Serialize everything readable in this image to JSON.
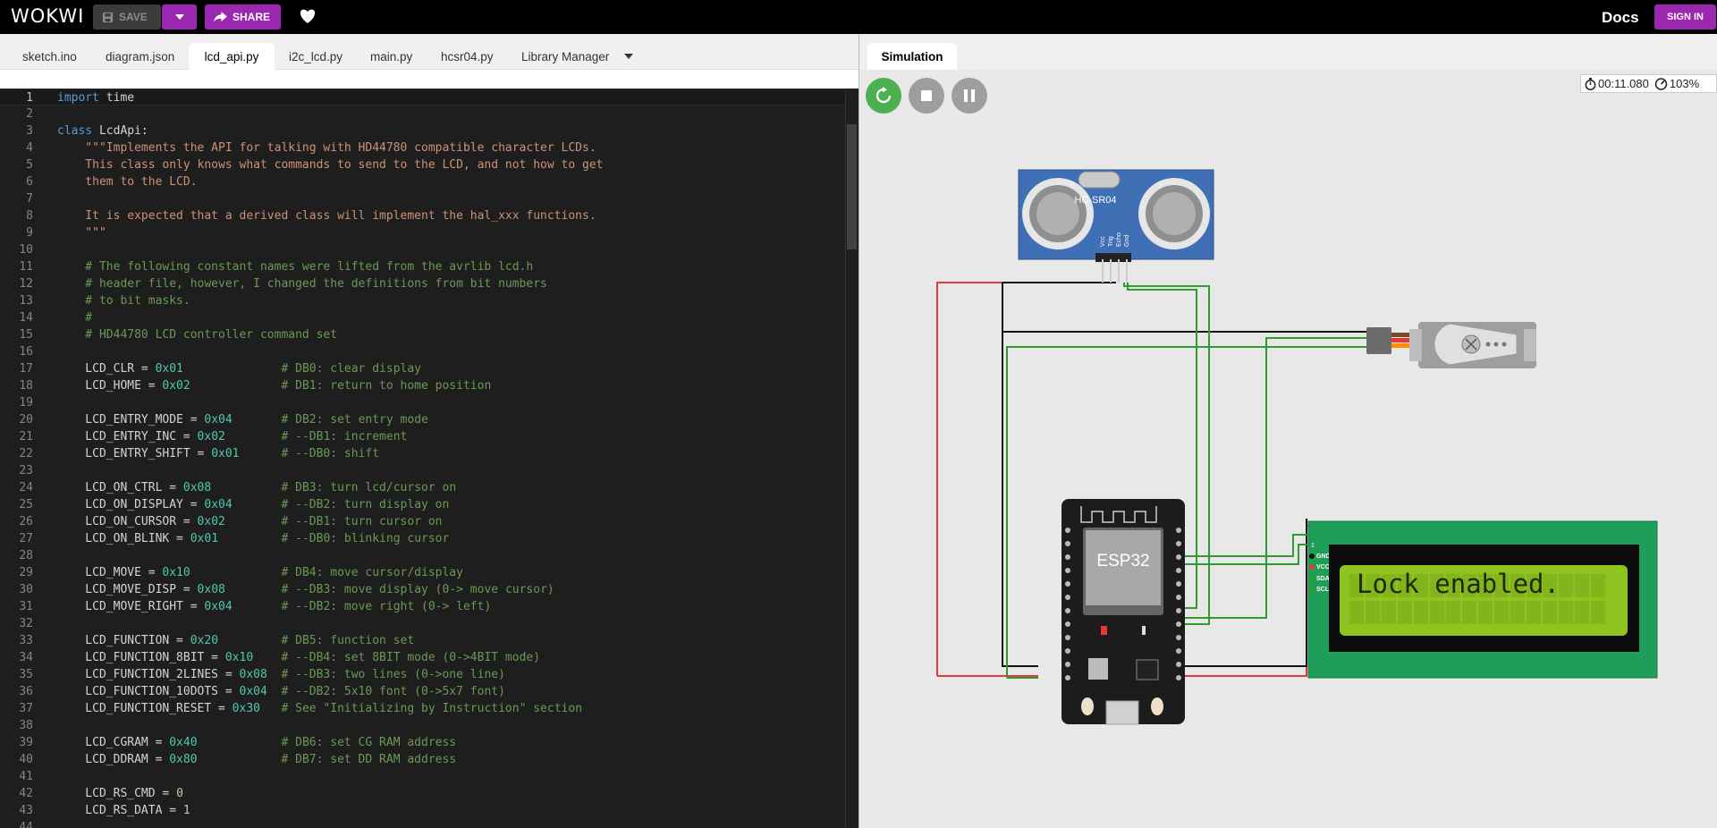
{
  "topbar": {
    "logo": "WOKWI",
    "save_label": "SAVE",
    "share_label": "SHARE",
    "docs_label": "Docs",
    "signin_label": "SIGN IN"
  },
  "editor": {
    "tabs": [
      {
        "label": "sketch.ino"
      },
      {
        "label": "diagram.json"
      },
      {
        "label": "lcd_api.py"
      },
      {
        "label": "i2c_lcd.py"
      },
      {
        "label": "main.py"
      },
      {
        "label": "hcsr04.py"
      },
      {
        "label": "Library Manager"
      }
    ],
    "active_tab": "lcd_api.py",
    "lines": [
      [
        [
          "kw",
          "import"
        ],
        [
          "t",
          " time"
        ]
      ],
      [],
      [
        [
          "kw",
          "class"
        ],
        [
          "t",
          " LcdApi:"
        ]
      ],
      [
        [
          "str",
          "    \"\"\"Implements the API for talking with HD44780 compatible character LCDs."
        ]
      ],
      [
        [
          "str",
          "    This class only knows what commands to send to the LCD, and not how to get"
        ]
      ],
      [
        [
          "str",
          "    them to the LCD."
        ]
      ],
      [],
      [
        [
          "str",
          "    It is expected that a derived class will implement the hal_xxx functions."
        ]
      ],
      [
        [
          "str",
          "    \"\"\""
        ]
      ],
      [],
      [
        [
          "cm",
          "    # The following constant names were lifted from the avrlib lcd.h"
        ]
      ],
      [
        [
          "cm",
          "    # header file, however, I changed the definitions from bit numbers"
        ]
      ],
      [
        [
          "cm",
          "    # to bit masks."
        ]
      ],
      [
        [
          "cm",
          "    #"
        ]
      ],
      [
        [
          "cm",
          "    # HD44780 LCD controller command set"
        ]
      ],
      [],
      [
        [
          "t",
          "    LCD_CLR = "
        ],
        [
          "hex",
          "0x01"
        ],
        [
          "t",
          "              "
        ],
        [
          "cm",
          "# DB0: clear display"
        ]
      ],
      [
        [
          "t",
          "    LCD_HOME = "
        ],
        [
          "hex",
          "0x02"
        ],
        [
          "t",
          "             "
        ],
        [
          "cm",
          "# DB1: return to home position"
        ]
      ],
      [],
      [
        [
          "t",
          "    LCD_ENTRY_MODE = "
        ],
        [
          "hex",
          "0x04"
        ],
        [
          "t",
          "       "
        ],
        [
          "cm",
          "# DB2: set entry mode"
        ]
      ],
      [
        [
          "t",
          "    LCD_ENTRY_INC = "
        ],
        [
          "hex",
          "0x02"
        ],
        [
          "t",
          "        "
        ],
        [
          "cm",
          "# --DB1: increment"
        ]
      ],
      [
        [
          "t",
          "    LCD_ENTRY_SHIFT = "
        ],
        [
          "hex",
          "0x01"
        ],
        [
          "t",
          "      "
        ],
        [
          "cm",
          "# --DB0: shift"
        ]
      ],
      [],
      [
        [
          "t",
          "    LCD_ON_CTRL = "
        ],
        [
          "hex",
          "0x08"
        ],
        [
          "t",
          "          "
        ],
        [
          "cm",
          "# DB3: turn lcd/cursor on"
        ]
      ],
      [
        [
          "t",
          "    LCD_ON_DISPLAY = "
        ],
        [
          "hex",
          "0x04"
        ],
        [
          "t",
          "       "
        ],
        [
          "cm",
          "# --DB2: turn display on"
        ]
      ],
      [
        [
          "t",
          "    LCD_ON_CURSOR = "
        ],
        [
          "hex",
          "0x02"
        ],
        [
          "t",
          "        "
        ],
        [
          "cm",
          "# --DB1: turn cursor on"
        ]
      ],
      [
        [
          "t",
          "    LCD_ON_BLINK = "
        ],
        [
          "hex",
          "0x01"
        ],
        [
          "t",
          "         "
        ],
        [
          "cm",
          "# --DB0: blinking cursor"
        ]
      ],
      [],
      [
        [
          "t",
          "    LCD_MOVE = "
        ],
        [
          "hex",
          "0x10"
        ],
        [
          "t",
          "             "
        ],
        [
          "cm",
          "# DB4: move cursor/display"
        ]
      ],
      [
        [
          "t",
          "    LCD_MOVE_DISP = "
        ],
        [
          "hex",
          "0x08"
        ],
        [
          "t",
          "        "
        ],
        [
          "cm",
          "# --DB3: move display (0-> move cursor)"
        ]
      ],
      [
        [
          "t",
          "    LCD_MOVE_RIGHT = "
        ],
        [
          "hex",
          "0x04"
        ],
        [
          "t",
          "       "
        ],
        [
          "cm",
          "# --DB2: move right (0-> left)"
        ]
      ],
      [],
      [
        [
          "t",
          "    LCD_FUNCTION = "
        ],
        [
          "hex",
          "0x20"
        ],
        [
          "t",
          "         "
        ],
        [
          "cm",
          "# DB5: function set"
        ]
      ],
      [
        [
          "t",
          "    LCD_FUNCTION_8BIT = "
        ],
        [
          "hex",
          "0x10"
        ],
        [
          "t",
          "    "
        ],
        [
          "cm",
          "# --DB4: set 8BIT mode (0->4BIT mode)"
        ]
      ],
      [
        [
          "t",
          "    LCD_FUNCTION_2LINES = "
        ],
        [
          "hex",
          "0x08"
        ],
        [
          "t",
          "  "
        ],
        [
          "cm",
          "# --DB3: two lines (0->one line)"
        ]
      ],
      [
        [
          "t",
          "    LCD_FUNCTION_10DOTS = "
        ],
        [
          "hex",
          "0x04"
        ],
        [
          "t",
          "  "
        ],
        [
          "cm",
          "# --DB2: 5x10 font (0->5x7 font)"
        ]
      ],
      [
        [
          "t",
          "    LCD_FUNCTION_RESET = "
        ],
        [
          "hex",
          "0x30"
        ],
        [
          "t",
          "   "
        ],
        [
          "cm",
          "# See \"Initializing by Instruction\" section"
        ]
      ],
      [],
      [
        [
          "t",
          "    LCD_CGRAM = "
        ],
        [
          "hex",
          "0x40"
        ],
        [
          "t",
          "            "
        ],
        [
          "cm",
          "# DB6: set CG RAM address"
        ]
      ],
      [
        [
          "t",
          "    LCD_DDRAM = "
        ],
        [
          "hex",
          "0x80"
        ],
        [
          "t",
          "            "
        ],
        [
          "cm",
          "# DB7: set DD RAM address"
        ]
      ],
      [],
      [
        [
          "t",
          "    LCD_RS_CMD = "
        ],
        [
          "num",
          "0"
        ]
      ],
      [
        [
          "t",
          "    LCD_RS_DATA = "
        ],
        [
          "num",
          "1"
        ]
      ],
      []
    ]
  },
  "simulation": {
    "tab_label": "Simulation",
    "timer": "00:11.080",
    "speed": "103%",
    "sensor_label": "HC-SR04",
    "sensor_pins": [
      "Vcc",
      "Trig",
      "Echo",
      "Gnd"
    ],
    "mcu_label": "ESP32",
    "lcd_pins": [
      "GND",
      "VCC",
      "SDA",
      "SCL"
    ],
    "lcd_pin_number": "1",
    "lcd_text": "Lock enabled."
  },
  "colors": {
    "accent": "#9c27b0",
    "run_green": "#4caf50",
    "wire_red": "#e53935",
    "wire_green": "#2e9d2e",
    "wire_black": "#111111",
    "lcd_board": "#1f9e5a",
    "lcd_screen": "#8fc31f"
  }
}
